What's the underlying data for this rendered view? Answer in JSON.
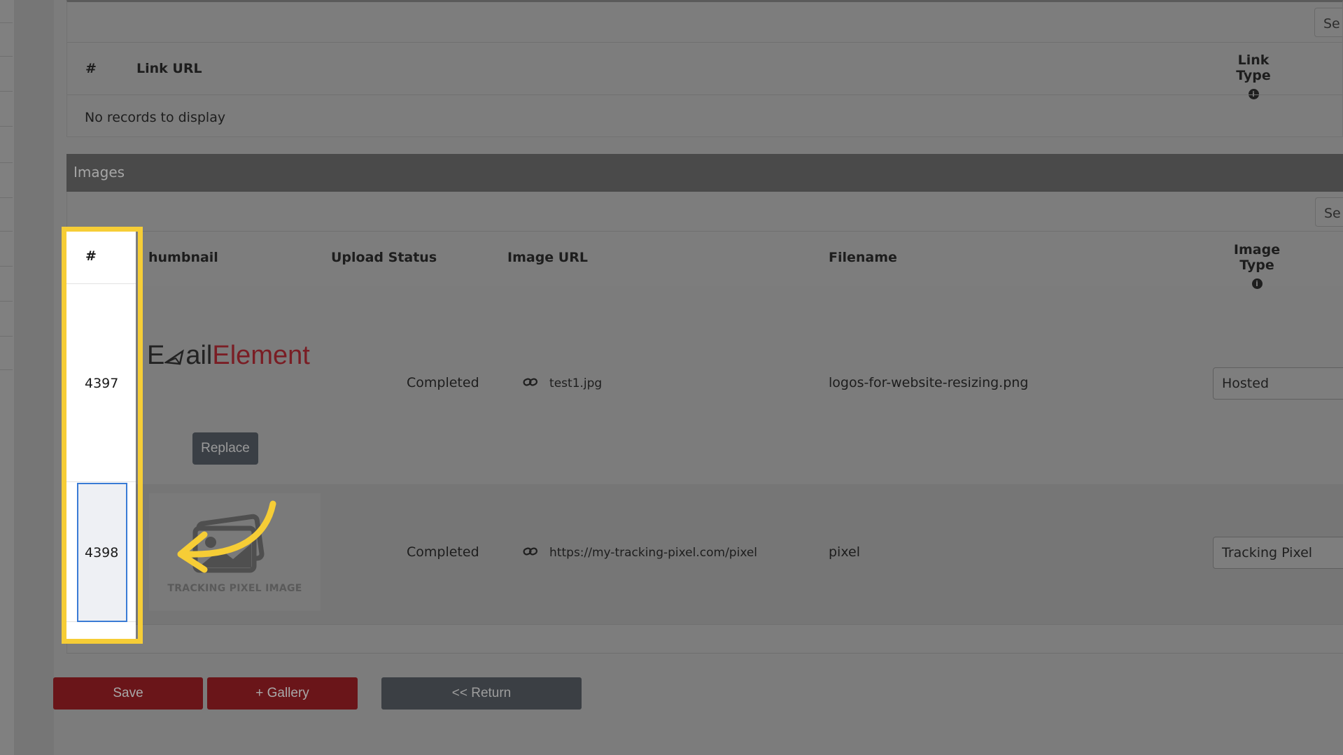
{
  "links": {
    "search_stub": "Se",
    "columns": {
      "num": "#",
      "link_url": "Link URL",
      "link_type": "Link Type"
    },
    "empty_text": "No records to display"
  },
  "images": {
    "title": "Images",
    "search_stub": "Se",
    "columns": {
      "num": "#",
      "thumbnail": "humbnail",
      "upload_status": "Upload Status",
      "image_url": "Image URL",
      "filename": "Filename",
      "image_type": "Image Type"
    },
    "rows": [
      {
        "id": "4397",
        "logo_part1": "E",
        "logo_part2": "ail",
        "logo_part3": "Element",
        "replace_label": "Replace",
        "status": "Completed",
        "image_url": "test1.jpg",
        "filename": "logos-for-website-resizing.png",
        "image_type": "Hosted"
      },
      {
        "id": "4398",
        "thumb_caption": "TRACKING PIXEL IMAGE",
        "status": "Completed",
        "image_url": "https://my-tracking-pixel.com/pixel",
        "filename": "pixel",
        "image_type": "Tracking Pixel"
      }
    ]
  },
  "actions": {
    "save": "Save",
    "gallery": "+ Gallery",
    "return": "<< Return"
  },
  "icons": {
    "info": "info-icon",
    "link": "link-icon",
    "chevron": "chevron-down-icon",
    "arrow": "curved-arrow-icon"
  },
  "colors": {
    "highlight": "#f6cd36",
    "primary_button": "#6a1519",
    "secondary_button": "#3b3f44",
    "logo_red": "#7a1d24"
  }
}
